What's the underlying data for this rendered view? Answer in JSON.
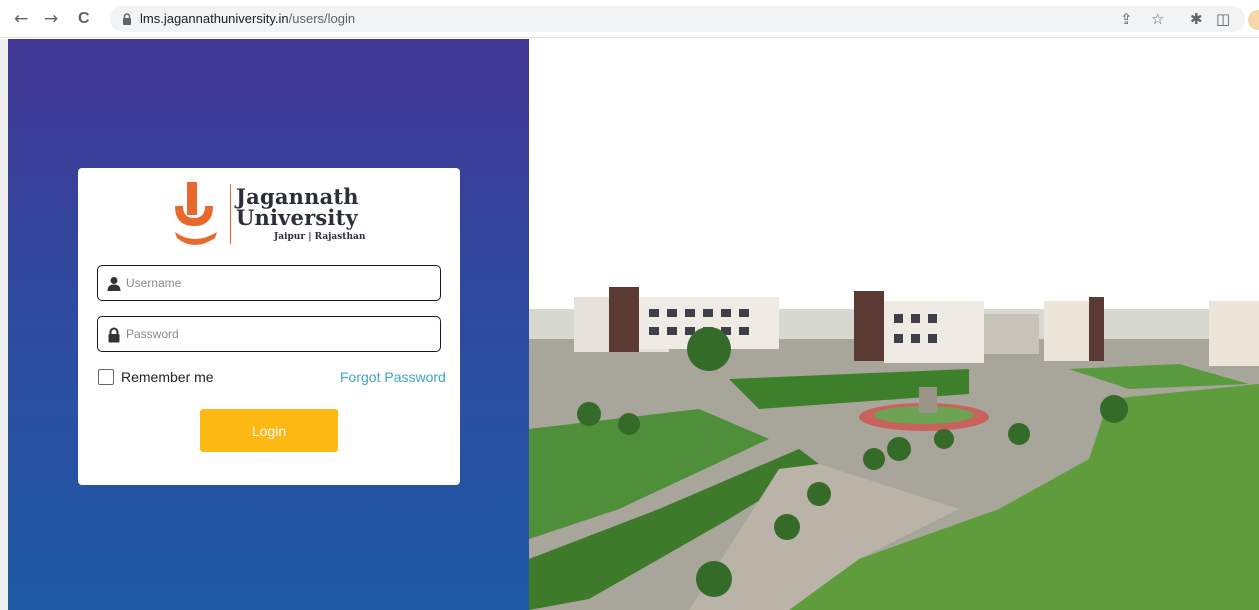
{
  "browser": {
    "url_domain": "lms.jagannathuniversity.in",
    "url_path": "/users/login",
    "back_glyph": "←",
    "forward_glyph": "→",
    "reload_glyph": "C",
    "share_glyph": "⇪",
    "star_glyph": "☆",
    "extensions_glyph": "✱",
    "panel_glyph": "◫"
  },
  "logo": {
    "line1": "Jagannath",
    "line2": "University",
    "line3": "Jaipur | Rajasthan",
    "accent_color": "#e8692c"
  },
  "form": {
    "username_placeholder": "Username",
    "password_placeholder": "Password",
    "remember_label": "Remember me",
    "forgot_label": "Forgot Password",
    "login_label": "Login",
    "button_color": "#fdb813",
    "link_color": "#3ea7c6"
  },
  "icons": {
    "back": "arrow-left-icon",
    "forward": "arrow-right-icon",
    "reload": "reload-icon",
    "lock": "lock-icon",
    "share": "share-icon",
    "bookmark": "star-icon",
    "extensions": "puzzle-icon",
    "sidepanel": "sidepanel-icon",
    "user": "user-icon",
    "password": "padlock-icon"
  }
}
